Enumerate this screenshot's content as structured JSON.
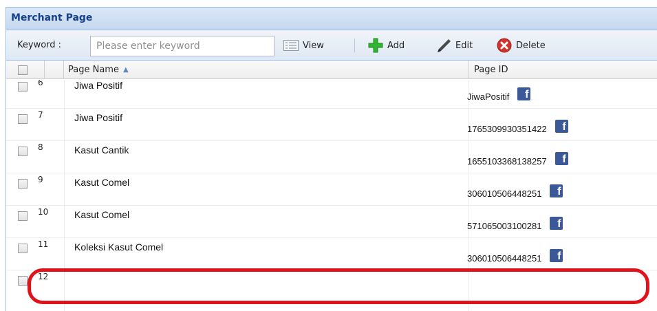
{
  "panel": {
    "title": "Merchant Page"
  },
  "toolbar": {
    "keyword_label": "Keyword :",
    "keyword_placeholder": "Please enter keyword",
    "keyword_value": "",
    "view_label": "View",
    "add_label": "Add",
    "edit_label": "Edit",
    "delete_label": "Delete"
  },
  "grid": {
    "columns": {
      "page_name": "Page Name",
      "page_id": "Page ID"
    },
    "sort": {
      "column": "page_name",
      "direction": "ascending"
    },
    "rows": [
      {
        "num": "6",
        "page_name": "Jiwa Positif",
        "page_id": "JiwaPositif"
      },
      {
        "num": "7",
        "page_name": "Jiwa Positif",
        "page_id": "1765309930351422"
      },
      {
        "num": "8",
        "page_name": "Kasut Cantik",
        "page_id": "1655103368138257"
      },
      {
        "num": "9",
        "page_name": "Kasut Comel",
        "page_id": "306010506448251"
      },
      {
        "num": "10",
        "page_name": "Kasut Comel",
        "page_id": "571065003100281"
      },
      {
        "num": "11",
        "page_name": "Koleksi Kasut Comel",
        "page_id": "306010506448251"
      },
      {
        "num": "12",
        "page_name": "",
        "page_id": ""
      }
    ]
  },
  "colors": {
    "highlight": "#e0131b",
    "facebook": "#3b5998",
    "header_text": "#15428b"
  }
}
